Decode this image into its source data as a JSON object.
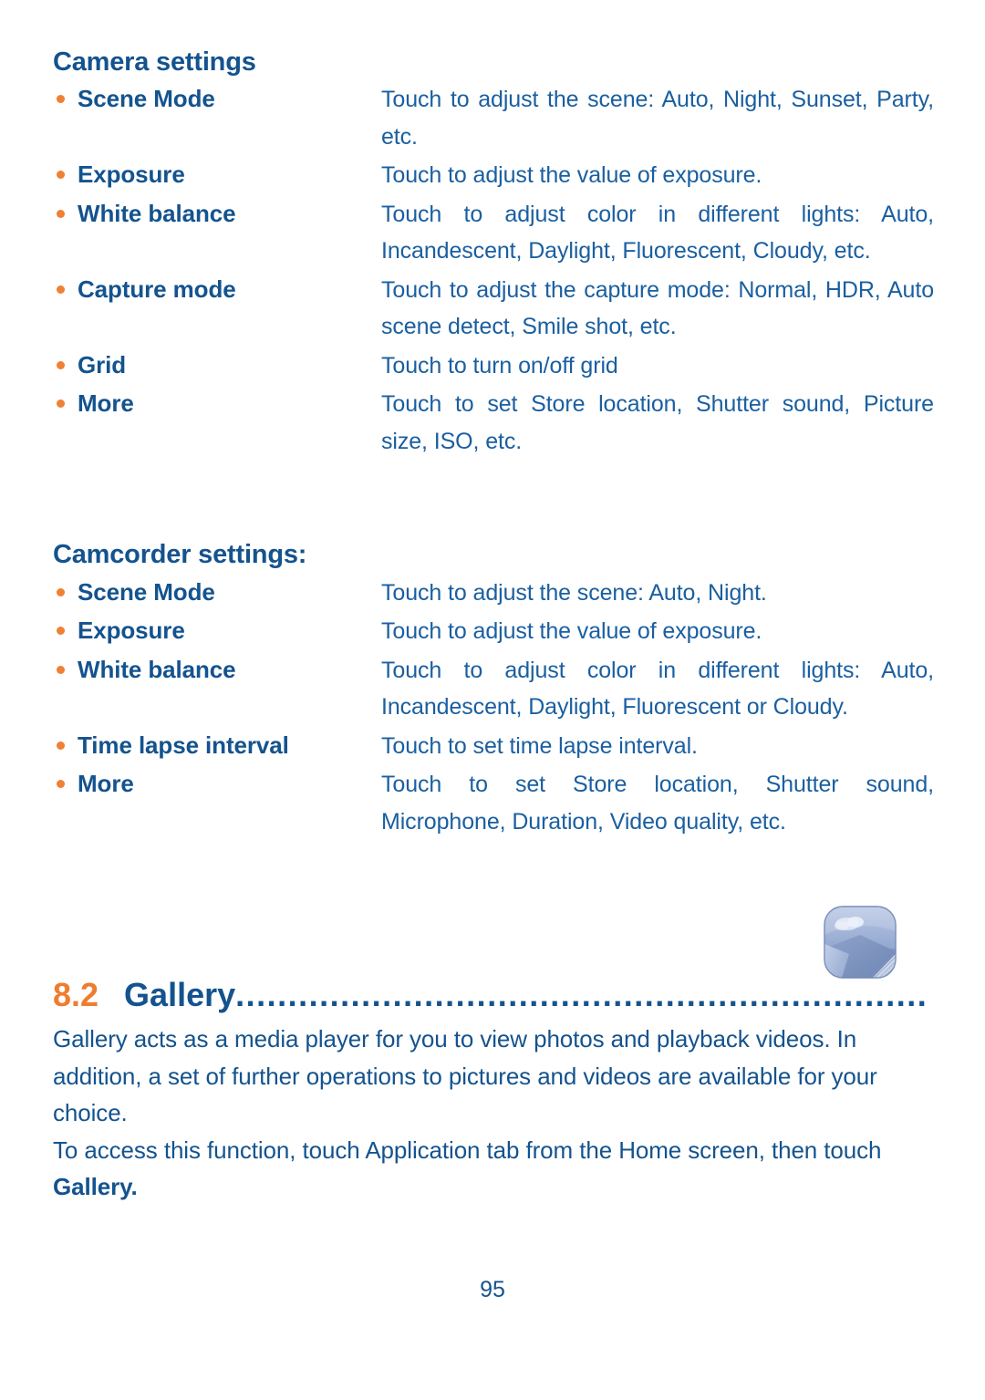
{
  "camera": {
    "heading": "Camera settings",
    "rows": [
      {
        "term": "Scene Mode",
        "desc": "Touch to adjust the scene: Auto, Night, Sunset, Party, etc.",
        "justify": true
      },
      {
        "term": "Exposure",
        "desc": "Touch to adjust the value of exposure.",
        "justify": false
      },
      {
        "term": "White balance",
        "desc": "Touch to adjust color in different lights: Auto, Incandescent, Daylight, Fluorescent, Cloudy, etc.",
        "justify": true
      },
      {
        "term": "Capture mode",
        "desc": "Touch to adjust the capture mode: Normal, HDR, Auto scene detect, Smile shot, etc.",
        "justify": true
      },
      {
        "term": "Grid",
        "desc": "Touch to turn on/off grid",
        "justify": false
      },
      {
        "term": "More",
        "desc": "Touch to set Store location, Shutter sound, Picture size, ISO, etc.",
        "justify": true
      }
    ]
  },
  "camcorder": {
    "heading": "Camcorder settings:",
    "rows": [
      {
        "term": "Scene Mode",
        "desc": "Touch to adjust the scene: Auto, Night.",
        "justify": false
      },
      {
        "term": "Exposure",
        "desc": "Touch to adjust the value of exposure.",
        "justify": false
      },
      {
        "term": "White balance",
        "desc": "Touch to adjust color in different lights: Auto, Incandescent, Daylight, Fluorescent or Cloudy.",
        "justify": true
      },
      {
        "term": "Time lapse interval",
        "desc": "Touch to set time lapse interval.",
        "justify": false
      },
      {
        "term": "More",
        "desc": "Touch to set Store location, Shutter sound, Microphone, Duration, Video quality, etc.",
        "justify": true
      }
    ]
  },
  "chapter": {
    "number": "8.2",
    "title": "Gallery",
    "leader": "...................................................................................",
    "icon_name": "gallery-icon"
  },
  "gallery_body": {
    "para1": "Gallery acts as a media player for you to view photos and playback videos. In addition, a set of further operations to pictures and videos are available for your choice.",
    "para2_prefix": "To access this function, touch Application tab from the Home screen, then touch ",
    "para2_bold": "Gallery."
  },
  "footer": {
    "page_number": "95"
  },
  "colors": {
    "heading_blue": "#14538e",
    "body_blue": "#1a5fa0",
    "bullet_orange": "#f08033",
    "chapter_orange": "#f07c2e"
  }
}
